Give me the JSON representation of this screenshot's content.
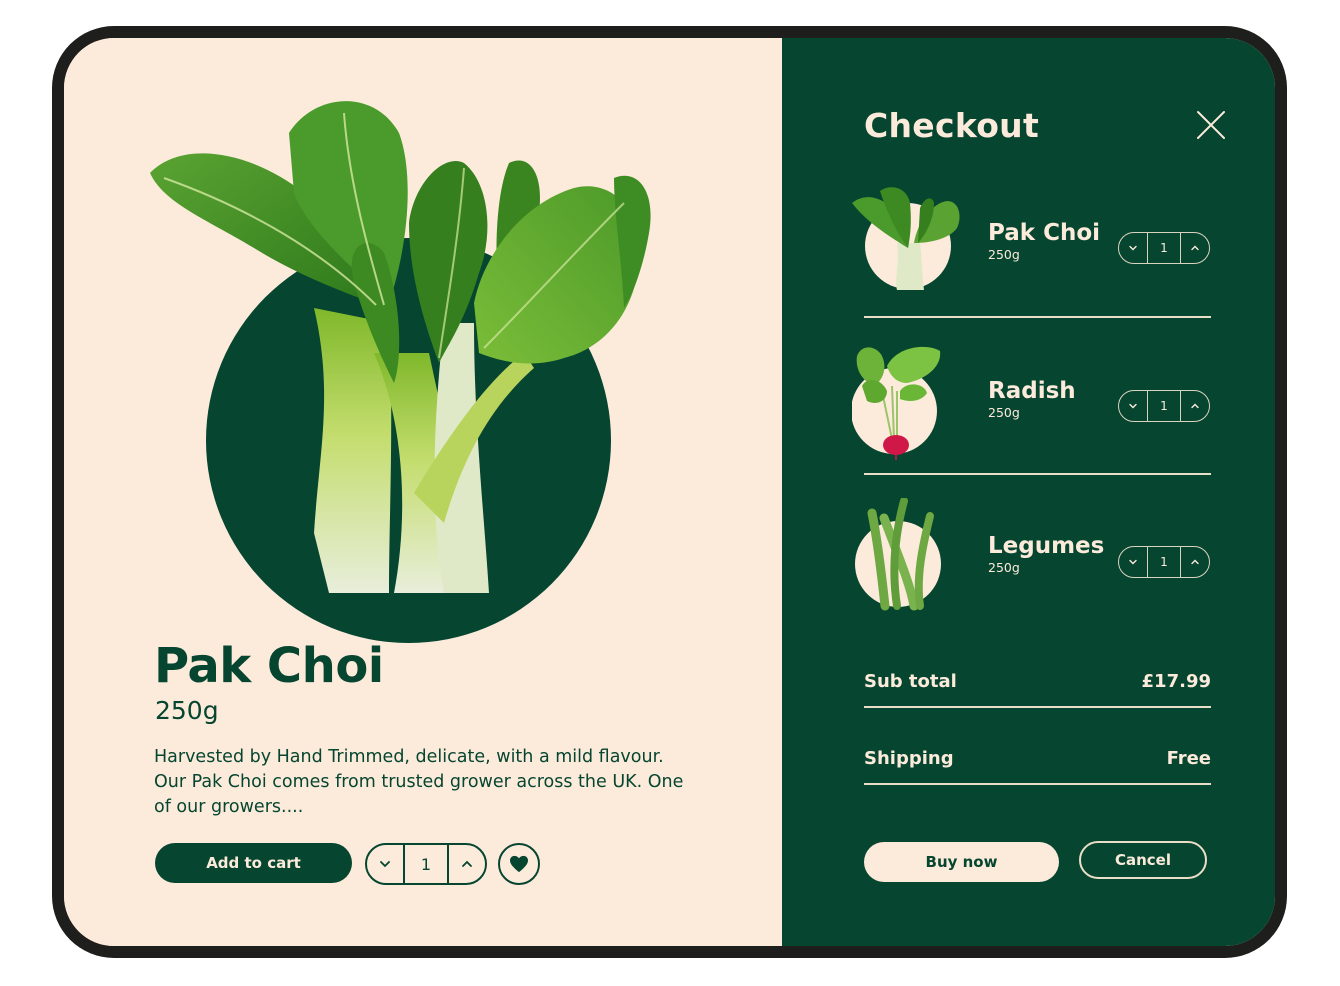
{
  "product": {
    "name": "Pak Choi",
    "weight": "250g",
    "description": "Harvested by Hand Trimmed, delicate, with a mild flavour. Our Pak Choi comes from trusted grower across the UK. One of our growers....",
    "add_to_cart_label": "Add to cart",
    "quantity": "1",
    "icons": {
      "decrease": "chevron-down-icon",
      "increase": "chevron-up-icon",
      "favorite": "heart-icon"
    }
  },
  "checkout": {
    "title": "Checkout",
    "close_icon": "close-icon",
    "items": [
      {
        "name": "Pak Choi",
        "weight": "250g",
        "quantity": "1",
        "image": "pak-choi"
      },
      {
        "name": "Radish",
        "weight": "250g",
        "quantity": "1",
        "image": "radish"
      },
      {
        "name": "Legumes",
        "weight": "250g",
        "quantity": "1",
        "image": "legumes"
      }
    ],
    "subtotal_label": "Sub total",
    "subtotal_value": "£17.99",
    "shipping_label": "Shipping",
    "shipping_value": "Free",
    "buy_now_label": "Buy now",
    "cancel_label": "Cancel"
  },
  "colors": {
    "cream": "#fcebdb",
    "forest_green": "#064530",
    "frame": "#1e1e1c",
    "leaf": "#3f8f2a",
    "radish_red": "#d01848"
  }
}
